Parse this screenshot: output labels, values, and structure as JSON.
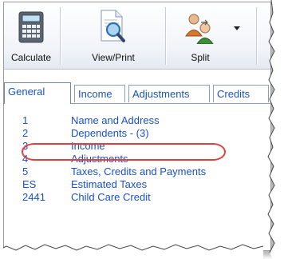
{
  "toolbar": {
    "buttons": [
      {
        "label": "Calculate",
        "icon": "calculator-icon"
      },
      {
        "label": "View/Print",
        "icon": "view-print-icon"
      },
      {
        "label": "Split",
        "icon": "split-users-icon"
      }
    ]
  },
  "tabs": [
    {
      "label": "General",
      "active": true
    },
    {
      "label": "Income",
      "active": false
    },
    {
      "label": "Adjustments",
      "active": false
    },
    {
      "label": "Credits",
      "active": false
    }
  ],
  "forms": [
    {
      "code": "1",
      "label": "Name and Address"
    },
    {
      "code": "2",
      "label": "Dependents - (3)",
      "highlighted": true
    },
    {
      "code": "3",
      "label": "Income"
    },
    {
      "code": "4",
      "label": "Adjustments"
    },
    {
      "code": "5",
      "label": "Taxes, Credits and Payments"
    },
    {
      "code": "ES",
      "label": "Estimated Taxes"
    },
    {
      "code": "2441",
      "label": "Child Care Credit"
    }
  ],
  "colors": {
    "link": "#1a52c4",
    "highlight": "#e04040"
  }
}
